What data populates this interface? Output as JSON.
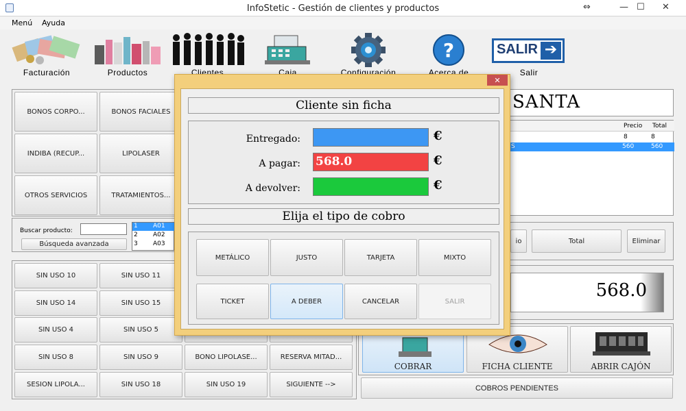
{
  "window": {
    "title": "InfoStetic - Gestión de clientes y productos",
    "resize_icon": "⇔",
    "min_icon": "—",
    "max_icon": "☐",
    "close_icon": "✕"
  },
  "menu": {
    "items": [
      "Menú",
      "Ayuda"
    ]
  },
  "toolbar": {
    "facturacion": "Facturación",
    "productos": "Productos",
    "clientes": "Clientes",
    "caja": "Caja",
    "configuracion": "Configuración",
    "acerca": "Acerca de",
    "salir": "Salir",
    "salir_sign": "SALIR"
  },
  "categories": [
    "BONOS CORPO...",
    "BONOS FACIALES",
    "INDIBA (RECUP...",
    "LIPOLASER",
    "OTROS SERVICIOS",
    "TRATAMIENTOS..."
  ],
  "search": {
    "label": "Buscar producto:",
    "value": "",
    "advanced_button": "Búsqueda avanzada",
    "results": [
      {
        "n": "1",
        "code": "A01"
      },
      {
        "n": "2",
        "code": "A02"
      },
      {
        "n": "3",
        "code": "A03"
      }
    ]
  },
  "products": [
    [
      "SIN USO 10",
      "SIN USO 11",
      "",
      ""
    ],
    [
      "SIN USO 14",
      "SIN USO 15",
      "",
      ""
    ],
    [
      "SIN USO 4",
      "SIN USO 5",
      "",
      ""
    ],
    [
      "SIN USO 8",
      "SIN USO 9",
      "BONO LIPOLASE...",
      "RESERVA MITAD..."
    ],
    [
      "SESION LIPOLA...",
      "SIN USO 18",
      "SIN USO 19",
      "SIGUIENTE -->"
    ]
  ],
  "client_name": "SANTA",
  "ticket_table": {
    "headers": [
      "Precio",
      "Total"
    ],
    "rows": [
      {
        "desc": "",
        "precio": "8",
        "total": "8",
        "selected": false
      },
      {
        "desc": "S",
        "precio": "560",
        "total": "560",
        "selected": true
      }
    ]
  },
  "ticket_actions": {
    "partial_label": "io",
    "total": "Total",
    "eliminar": "Eliminar"
  },
  "total_display": "568.0",
  "bottom_actions": {
    "cobrar": "COBRAR",
    "ficha": "FICHA CLIENTE",
    "abrir": "ABRIR CAJÓN",
    "pendientes": "COBROS PENDIENTES"
  },
  "dialog": {
    "close_icon": "✕",
    "title": "Cliente sin ficha",
    "entregado_label": "Entregado:",
    "entregado_value": "",
    "pagar_label": "A pagar:",
    "pagar_value": "568.0",
    "devolver_label": "A devolver:",
    "devolver_value": "",
    "currency": "€",
    "tipo_title": "Elija el tipo de cobro",
    "buttons_row1": [
      "METÁLICO",
      "JUSTO",
      "TARJETA",
      "MIXTO"
    ],
    "buttons_row2": [
      "TICKET",
      "A DEBER",
      "CANCELAR",
      "SALIR"
    ]
  },
  "colors": {
    "entregado": "#3d97f3",
    "pagar": "#f24343",
    "devolver": "#1bc93c",
    "dialog_frame": "#f3cf7c",
    "selection": "#3399ff"
  }
}
